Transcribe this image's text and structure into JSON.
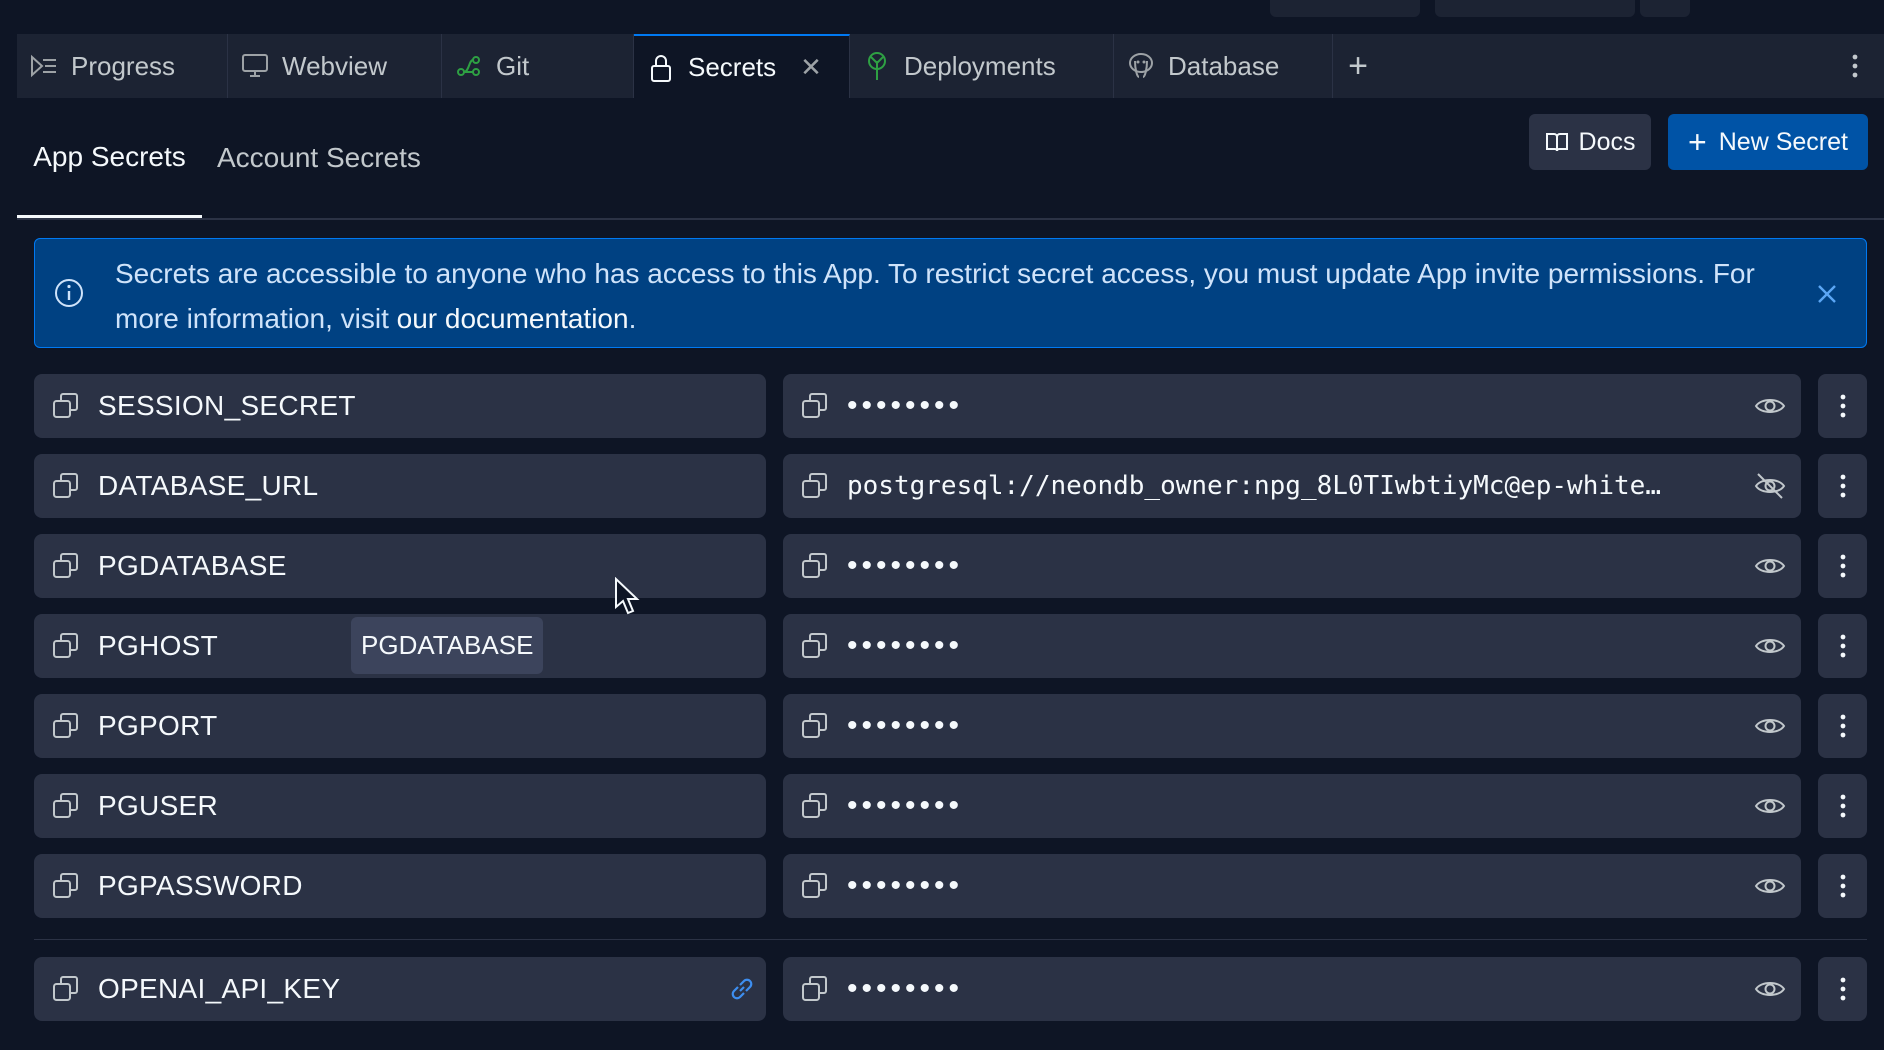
{
  "tabs": [
    {
      "label": "Progress",
      "icon": "progress-icon",
      "active": false
    },
    {
      "label": "Webview",
      "icon": "monitor-icon",
      "active": false
    },
    {
      "label": "Git",
      "icon": "git-icon",
      "active": false
    },
    {
      "label": "Secrets",
      "icon": "lock-icon",
      "active": true
    },
    {
      "label": "Deployments",
      "icon": "deployments-icon",
      "active": false
    },
    {
      "label": "Database",
      "icon": "database-icon",
      "active": false
    }
  ],
  "subtabs": {
    "app": "App Secrets",
    "account": "Account Secrets"
  },
  "buttons": {
    "docs": "Docs",
    "new_secret": "New Secret"
  },
  "banner": {
    "text": "Secrets are accessible to anyone who has access to this App. To restrict secret access, you must update App invite permissions. For more information, visit ",
    "link": "our documentation",
    "suffix": "."
  },
  "secrets": [
    {
      "key": "SESSION_SECRET",
      "value": "••••••••",
      "revealed": false
    },
    {
      "key": "DATABASE_URL",
      "value": "postgresql://neondb_owner:npg_8L0TIwbtiyMc@ep-white…",
      "revealed": true
    },
    {
      "key": "PGDATABASE",
      "value": "••••••••",
      "revealed": false
    },
    {
      "key": "PGHOST",
      "value": "••••••••",
      "revealed": false
    },
    {
      "key": "PGPORT",
      "value": "••••••••",
      "revealed": false
    },
    {
      "key": "PGUSER",
      "value": "••••••••",
      "revealed": false
    },
    {
      "key": "PGPASSWORD",
      "value": "••••••••",
      "revealed": false
    }
  ],
  "linked_secret": {
    "key": "OPENAI_API_KEY",
    "value": "••••••••",
    "revealed": false
  },
  "tooltip": "PGDATABASE",
  "colors": {
    "accent": "#0079f2",
    "primary_button": "#0053a6",
    "banner_bg": "#004182",
    "surface": "#2b3245",
    "background": "#0e1525"
  }
}
